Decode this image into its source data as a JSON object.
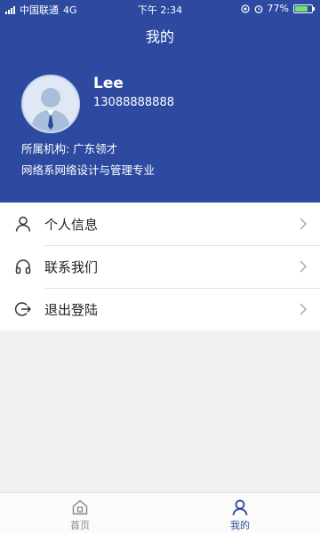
{
  "status_bar": {
    "carrier": "中国联通",
    "network": "4G",
    "time": "下午 2:34",
    "battery": "77%"
  },
  "header": {
    "title": "我的"
  },
  "profile": {
    "name": "Lee",
    "phone": "13088888888",
    "organization": "所属机构: 广东领才",
    "major": "网络系网络设计与管理专业"
  },
  "menu": {
    "items": [
      {
        "label": "个人信息",
        "icon": "person-icon"
      },
      {
        "label": "联系我们",
        "icon": "headphones-icon"
      },
      {
        "label": "退出登陆",
        "icon": "logout-icon"
      }
    ]
  },
  "tabbar": {
    "tabs": [
      {
        "label": "首页",
        "icon": "home-icon",
        "active": false
      },
      {
        "label": "我的",
        "icon": "user-icon",
        "active": true
      }
    ]
  },
  "colors": {
    "header_bg": "#2d4aa0",
    "active_tab": "#2d4aa0",
    "inactive_tab": "#888888",
    "page_bg": "#f1f1f4"
  }
}
